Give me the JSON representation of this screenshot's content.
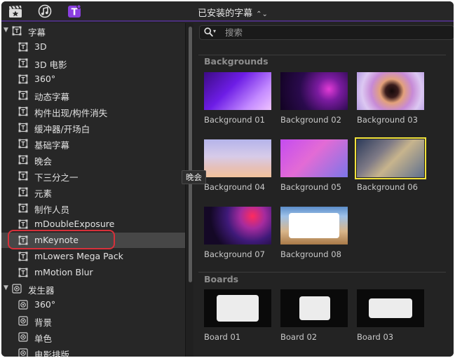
{
  "toolbar": {
    "icons": [
      "movie-clapper-icon",
      "music-note-icon",
      "titles-icon"
    ],
    "library_title": "已安装的字幕",
    "library_chevron": "⌃⌄"
  },
  "sidebar": {
    "cat_titles": "字幕",
    "items_titles": [
      "3D",
      "3D 电影",
      "360°",
      "动态字幕",
      "构件出现/构件消失",
      "缓冲器/开场白",
      "基础字幕",
      "晚会",
      "下三分之一",
      "元素",
      "制作人员",
      "mDoubleExposure",
      "mKeynote",
      "mLowers Mega Pack",
      "mMotion Blur"
    ],
    "cat_generators": "发生器",
    "items_generators": [
      "360°",
      "背景",
      "单色",
      "电影排版"
    ],
    "selected": "mKeynote"
  },
  "tooltip": "晚会",
  "search": {
    "placeholder": "搜索"
  },
  "sections": {
    "backgrounds": {
      "title": "Backgrounds",
      "items": [
        "Background 01",
        "Background 02",
        "Background 03",
        "Background 04",
        "Background 05",
        "Background 06",
        "Background 07",
        "Background 08"
      ],
      "selected": "Background 06"
    },
    "boards": {
      "title": "Boards",
      "items": [
        "Board 01",
        "Board 02",
        "Board 03"
      ]
    }
  },
  "colors": {
    "accent": "#4b2f7c",
    "selection": "#f2e33c",
    "highlight_ring": "#d8303a"
  }
}
